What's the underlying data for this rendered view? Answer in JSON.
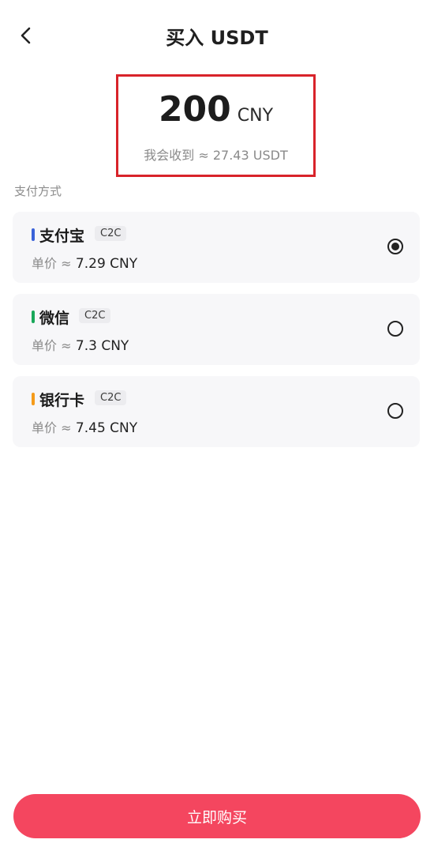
{
  "header": {
    "title": "买入 USDT",
    "back_icon": "chevron-left-icon"
  },
  "amount": {
    "value": "200",
    "unit": "CNY",
    "receive_text": "我会收到 ≈ 27.43 USDT"
  },
  "section_label": "支付方式",
  "methods": [
    {
      "name": "支付宝",
      "tag": "C2C",
      "price_label": "单价 ≈",
      "price": "7.29 CNY",
      "color": "#3b63d9",
      "selected": true
    },
    {
      "name": "微信",
      "tag": "C2C",
      "price_label": "单价 ≈",
      "price": "7.3 CNY",
      "color": "#1aa85a",
      "selected": false
    },
    {
      "name": "银行卡",
      "tag": "C2C",
      "price_label": "单价 ≈",
      "price": "7.45 CNY",
      "color": "#f59b1a",
      "selected": false
    }
  ],
  "buy_button": {
    "label": "立即购买",
    "color": "#f4465f"
  }
}
